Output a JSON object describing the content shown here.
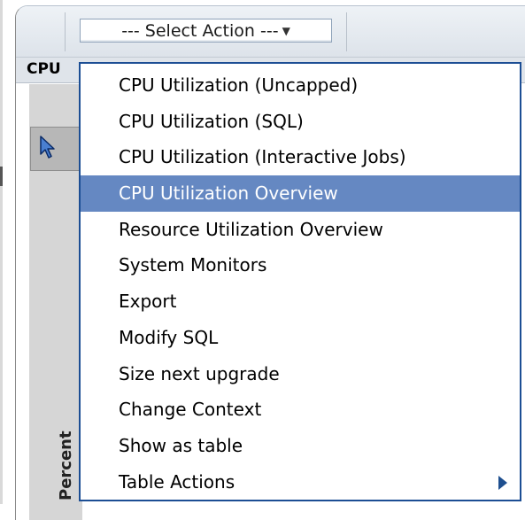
{
  "toolbar": {
    "select_action_label": "--- Select Action ---",
    "dropdown_icon": "triangle-down-icon"
  },
  "section": {
    "label": "CPU"
  },
  "chart": {
    "y_axis_title": "Percent"
  },
  "menu": {
    "items": [
      {
        "label": "CPU Utilization (Uncapped)"
      },
      {
        "label": "CPU Utilization (SQL)"
      },
      {
        "label": "CPU Utilization (Interactive Jobs)"
      },
      {
        "label": "CPU Utilization Overview",
        "selected": true
      },
      {
        "label": "Resource Utilization Overview"
      },
      {
        "label": "System Monitors"
      },
      {
        "label": "Export"
      },
      {
        "label": "Modify SQL"
      },
      {
        "label": "Size next upgrade"
      },
      {
        "label": "Change Context"
      },
      {
        "label": "Show as table"
      },
      {
        "label": "Table Actions",
        "has_submenu": true
      }
    ]
  },
  "colors": {
    "menu_border": "#1c4e94",
    "menu_highlight": "#6588c2",
    "submenu_arrow": "#1e4f8f"
  }
}
